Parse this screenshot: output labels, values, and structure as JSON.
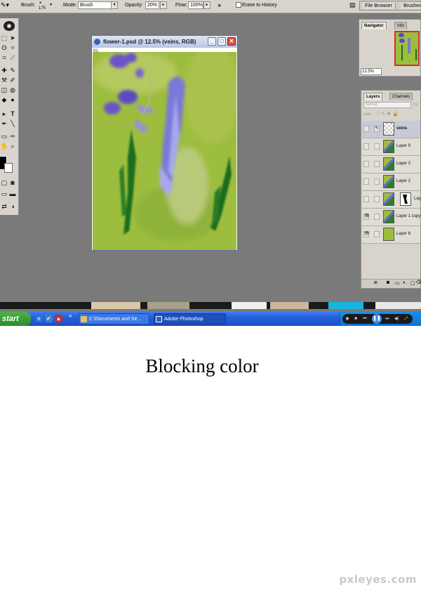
{
  "options_bar": {
    "brush_label": "Brush:",
    "brush_size": "175",
    "mode_label": "Mode:",
    "mode_value": "Brush",
    "opacity_label": "Opacity:",
    "opacity_value": "20%",
    "flow_label": "Flow:",
    "flow_value": "100%",
    "erase_to_history_label": "Erase to History",
    "palette_well_tabs": [
      "File Browser",
      "Brushes"
    ]
  },
  "document": {
    "title": "flower-1.psd @ 12.5% (veins, RGB)",
    "ruler_tag": "01",
    "buttons": {
      "minimize": "_",
      "maximize": "□",
      "close": "✕"
    }
  },
  "navigator_panel": {
    "tabs": [
      "Navigator",
      "Info"
    ],
    "zoom_value": "12.5%"
  },
  "layers_panel": {
    "tabs": [
      "Layers",
      "Channels"
    ],
    "blend_mode": "Normal",
    "opacity_abbrev": "Op",
    "lock_label": "Lock:",
    "layers": [
      {
        "name": "veins",
        "visible": false,
        "selected": true,
        "thumb": "transparent"
      },
      {
        "name": "Layer 9",
        "visible": false,
        "selected": false,
        "thumb": "flower"
      },
      {
        "name": "Layer 3",
        "visible": false,
        "selected": false,
        "thumb": "flower"
      },
      {
        "name": "Layer 2",
        "visible": false,
        "selected": false,
        "thumb": "flower"
      },
      {
        "name": "Lay",
        "visible": false,
        "selected": false,
        "thumb": "flower",
        "mask": true
      },
      {
        "name": "Layer 1 copy",
        "visible": true,
        "selected": false,
        "thumb": "flower"
      },
      {
        "name": "Layer 6",
        "visible": true,
        "selected": false,
        "thumb": "green"
      }
    ]
  },
  "taskbar": {
    "start_label": "start",
    "overflow_label": "»",
    "buttons": [
      {
        "label": "C:\\Documents and Se...",
        "icon": "folder-icon"
      },
      {
        "label": "Adobe Photoshop",
        "icon": "photoshop-icon"
      }
    ]
  },
  "caption": "Blocking color",
  "watermark": "pxleyes.com",
  "colors": {
    "canvas_bg": "#9dbd3e",
    "workspace": "#7a7a7a",
    "taskbar_blue": "#245edb",
    "start_green": "#3a9a34",
    "flower_purple": "#5e4ec4",
    "stem_green": "#1f6e1f"
  }
}
